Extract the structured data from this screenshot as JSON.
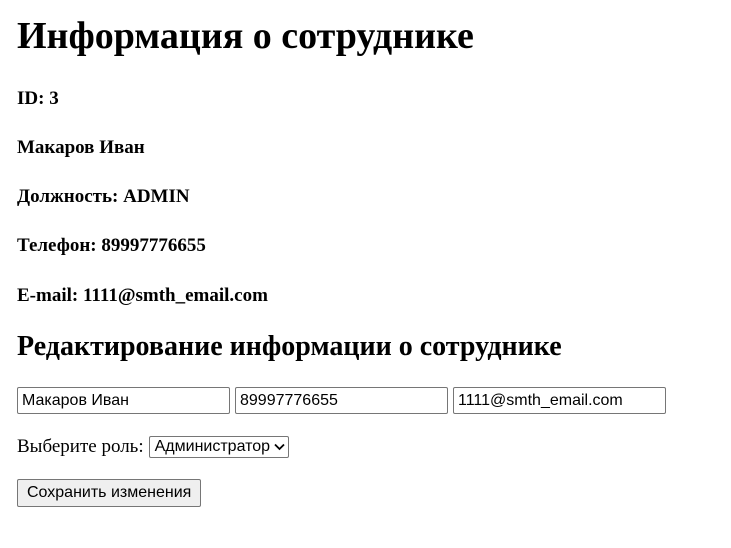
{
  "page": {
    "title": "Информация о сотруднике",
    "section_title": "Редактирование информации о сотруднике"
  },
  "employee": {
    "id_line": "ID: 3",
    "name_line": "Макаров Иван",
    "position_line": "Должность: ADMIN",
    "phone_line": "Телефон: 89997776655",
    "email_line": "E-mail: 1111@smth_email.com"
  },
  "form": {
    "name_value": "Макаров Иван",
    "phone_value": "89997776655",
    "email_value": "1111@smth_email.com",
    "role_label": "Выберите роль:",
    "role_selected": "Администратор",
    "save_label": "Сохранить изменения"
  },
  "icons": {
    "role_select_chevron": "chevron-down-icon"
  }
}
